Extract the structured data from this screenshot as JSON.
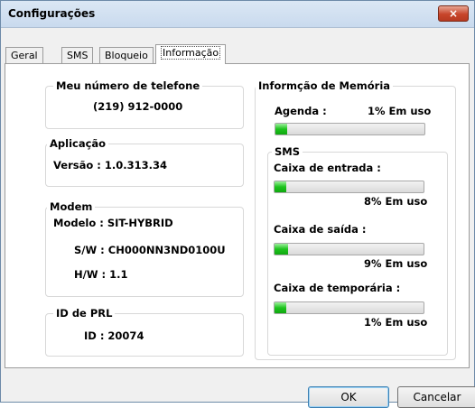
{
  "window": {
    "title": "Configurações",
    "close_label": "×"
  },
  "tabs": [
    {
      "label": "Geral",
      "active": false
    },
    {
      "label": "SMS",
      "active": false
    },
    {
      "label": "Bloqueio",
      "active": false
    },
    {
      "label": "Informação",
      "active": true
    }
  ],
  "phone": {
    "heading": "Meu número de telefone",
    "number": "(219) 912-0000"
  },
  "application": {
    "heading": "Aplicação",
    "version": "Versão : 1.0.313.34"
  },
  "modem": {
    "heading": "Modem",
    "model": "Modelo : SIT-HYBRID",
    "sw": "S/W : CH000NN3ND0100U",
    "hw": "H/W : 1.1"
  },
  "prl": {
    "heading": "ID de PRL",
    "id": "ID : 20074"
  },
  "memory": {
    "heading": "Informção de Memória",
    "agenda": {
      "label": "Agenda :",
      "usage_text": "1% Em uso",
      "percent": 1
    },
    "sms": {
      "heading": "SMS",
      "inbox": {
        "label": "Caixa de entrada :",
        "usage_text": "8% Em uso",
        "percent": 8
      },
      "outbox": {
        "label": "Caixa de saída :",
        "usage_text": "9% Em uso",
        "percent": 9
      },
      "temp": {
        "label": "Caixa de temporária :",
        "usage_text": "1% Em uso",
        "percent": 1
      }
    }
  },
  "buttons": {
    "ok": "OK",
    "cancel": "Cancelar"
  },
  "colors": {
    "progress_fill": "#1ec31e",
    "close_button": "#c7452a"
  }
}
